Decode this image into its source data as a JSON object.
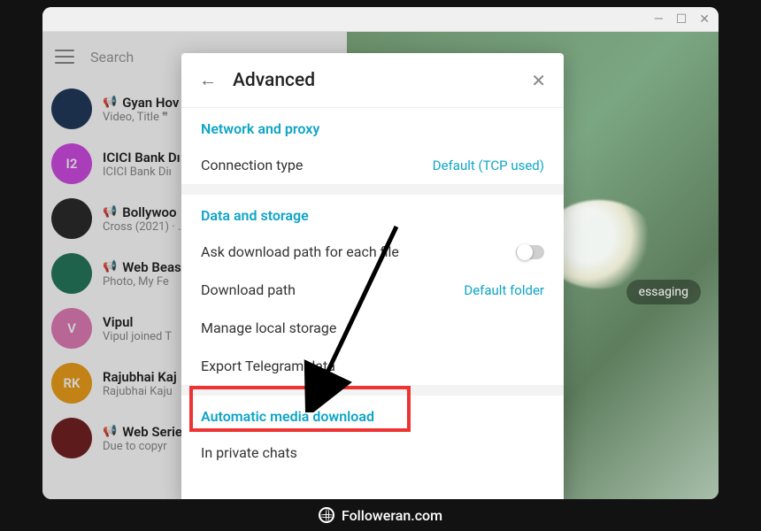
{
  "window": {
    "minimize": "—",
    "maximize": "☐",
    "close": "✕"
  },
  "sidebar": {
    "search_placeholder": "Search",
    "chats": [
      {
        "title": "Gyan Hov",
        "sub": "Video, Title ❞",
        "horn": true,
        "bg": "#1e3a5f",
        "initials": ""
      },
      {
        "title": "ICICI Bank Dı",
        "sub": "ICICI Bank Diı",
        "horn": false,
        "bg": "#d946ef",
        "initials": "I2"
      },
      {
        "title": "Bollywoo",
        "sub": "Cross (2021) · …",
        "horn": true,
        "bg": "#2b2b2b",
        "initials": ""
      },
      {
        "title": "Web Beas",
        "sub": "Photo, My Fe",
        "horn": true,
        "bg": "#1f7a5a",
        "initials": ""
      },
      {
        "title": "Vipul",
        "sub": "Vipul joined T",
        "horn": false,
        "bg": "#e879b9",
        "initials": "V"
      },
      {
        "title": "Rajubhai Kaj",
        "sub": "Rajubhai Kaju",
        "horn": false,
        "bg": "#f59e0b",
        "initials": "RK"
      },
      {
        "title": "Web Serie",
        "sub": "Due to copyr",
        "horn": true,
        "bg": "#7a1f1f",
        "initials": ""
      }
    ]
  },
  "right": {
    "badge": "essaging"
  },
  "dialog": {
    "title": "Advanced",
    "sec_network": "Network and proxy",
    "connection_type_label": "Connection type",
    "connection_type_value": "Default (TCP used)",
    "sec_data": "Data and storage",
    "ask_download_path": "Ask download path for each file",
    "download_path_label": "Download path",
    "download_path_value": "Default folder",
    "manage_local": "Manage local storage",
    "export": "Export Telegram data",
    "sec_auto": "Automatic media download",
    "in_private": "In private chats"
  },
  "footer": {
    "text": "Followeran.com"
  }
}
